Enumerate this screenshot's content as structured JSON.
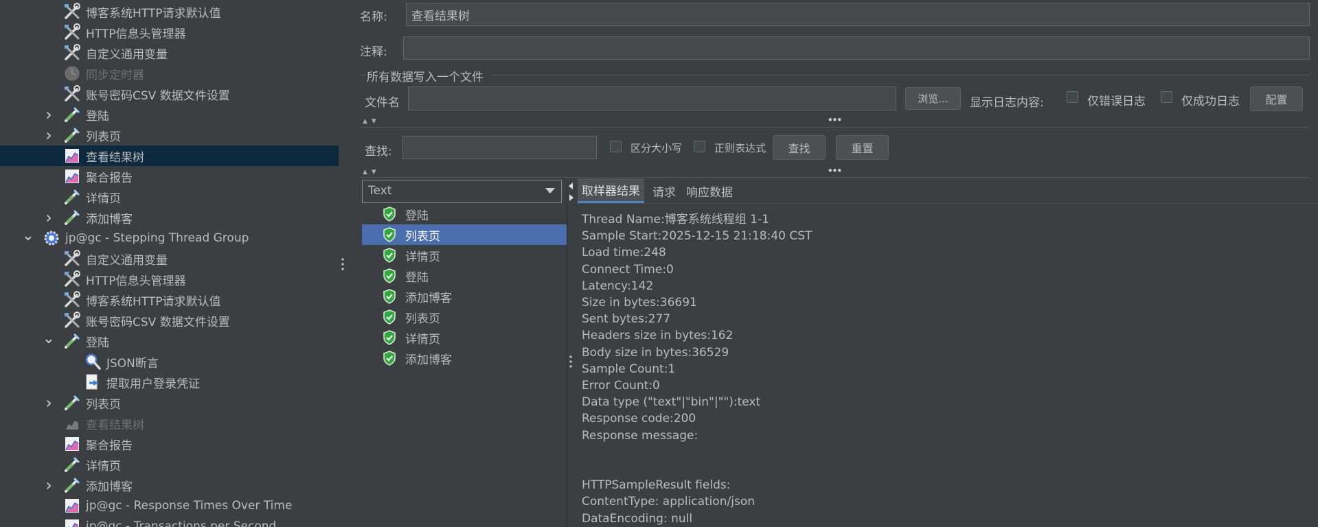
{
  "tree": {
    "items": [
      {
        "label": "博客系统HTTP请求默认值",
        "icon": "wrench-icon",
        "chevron": "",
        "disabled": false,
        "selected": false
      },
      {
        "label": "HTTP信息头管理器",
        "icon": "wrench-icon",
        "chevron": "",
        "disabled": false,
        "selected": false
      },
      {
        "label": "自定义通用变量",
        "icon": "wrench-icon",
        "chevron": "",
        "disabled": false,
        "selected": false
      },
      {
        "label": "同步定时器",
        "icon": "timer-icon",
        "chevron": "",
        "disabled": true,
        "selected": false
      },
      {
        "label": "账号密码CSV 数据文件设置",
        "icon": "wrench-icon",
        "chevron": "",
        "disabled": false,
        "selected": false
      },
      {
        "label": "登陆",
        "icon": "pipette-icon",
        "chevron": "collapsed",
        "disabled": false,
        "selected": false
      },
      {
        "label": "列表页",
        "icon": "pipette-icon",
        "chevron": "collapsed",
        "disabled": false,
        "selected": false
      },
      {
        "label": "查看结果树",
        "icon": "graph-icon",
        "chevron": "",
        "disabled": false,
        "selected": true
      },
      {
        "label": "聚合报告",
        "icon": "graph-icon",
        "chevron": "",
        "disabled": false,
        "selected": false
      },
      {
        "label": "详情页",
        "icon": "pipette-icon",
        "chevron": "",
        "disabled": false,
        "selected": false
      },
      {
        "label": "添加博客",
        "icon": "pipette-icon",
        "chevron": "collapsed",
        "disabled": false,
        "selected": false
      },
      {
        "label": "jp@gc - Stepping Thread Group",
        "icon": "gear-icon",
        "chevron": "expanded",
        "disabled": false,
        "selected": false
      },
      {
        "label": "自定义通用变量",
        "icon": "wrench-icon",
        "chevron": "",
        "disabled": false,
        "selected": false
      },
      {
        "label": "HTTP信息头管理器",
        "icon": "wrench-icon",
        "chevron": "",
        "disabled": false,
        "selected": false
      },
      {
        "label": "博客系统HTTP请求默认值",
        "icon": "wrench-icon",
        "chevron": "",
        "disabled": false,
        "selected": false
      },
      {
        "label": "账号密码CSV 数据文件设置",
        "icon": "wrench-icon",
        "chevron": "",
        "disabled": false,
        "selected": false
      },
      {
        "label": "登陆",
        "icon": "pipette-icon",
        "chevron": "expanded",
        "disabled": false,
        "selected": false
      },
      {
        "label": "JSON断言",
        "icon": "magnifier-icon",
        "chevron": "",
        "disabled": false,
        "selected": false
      },
      {
        "label": "提取用户登录凭证",
        "icon": "extractor-icon",
        "chevron": "",
        "disabled": false,
        "selected": false
      },
      {
        "label": "列表页",
        "icon": "pipette-icon",
        "chevron": "collapsed",
        "disabled": false,
        "selected": false
      },
      {
        "label": "查看结果树",
        "icon": "graph-icon",
        "chevron": "",
        "disabled": true,
        "selected": false
      },
      {
        "label": "聚合报告",
        "icon": "graph-icon",
        "chevron": "",
        "disabled": false,
        "selected": false
      },
      {
        "label": "详情页",
        "icon": "pipette-icon",
        "chevron": "",
        "disabled": false,
        "selected": false
      },
      {
        "label": "添加博客",
        "icon": "pipette-icon",
        "chevron": "collapsed",
        "disabled": false,
        "selected": false
      },
      {
        "label": "jp@gc - Response Times Over Time",
        "icon": "graph-icon",
        "chevron": "",
        "disabled": false,
        "selected": false
      },
      {
        "label": "jp@gc - Transactions per Second",
        "icon": "graph-icon",
        "chevron": "",
        "disabled": false,
        "selected": false
      }
    ]
  },
  "form": {
    "name_label": "名称:",
    "name_value": "查看结果树",
    "comment_label": "注释:",
    "comment_value": "",
    "file_section_title": "所有数据写入一个文件",
    "filename_label": "文件名",
    "filename_value": "",
    "browse_button": "浏览...",
    "log_display_label": "显示日志内容:",
    "errors_only_label": "仅错误日志",
    "success_only_label": "仅成功日志",
    "configure_button": "配置"
  },
  "search": {
    "label": "查找:",
    "value": "",
    "case_sensitive_label": "区分大小写",
    "regex_label": "正则表达式",
    "find_button": "查找",
    "reset_button": "重置"
  },
  "results": {
    "renderer_selected": "Text",
    "items": [
      {
        "label": "登陆",
        "status": "success"
      },
      {
        "label": "列表页",
        "status": "success",
        "selected": true
      },
      {
        "label": "详情页",
        "status": "success"
      },
      {
        "label": "登陆",
        "status": "success"
      },
      {
        "label": "添加博客",
        "status": "success"
      },
      {
        "label": "列表页",
        "status": "success"
      },
      {
        "label": "详情页",
        "status": "success"
      },
      {
        "label": "添加博客",
        "status": "success"
      }
    ]
  },
  "detail": {
    "tabs": [
      "取样器结果",
      "请求",
      "响应数据"
    ],
    "active_tab": "取样器结果",
    "lines": [
      "Thread Name:博客系统线程组 1-1",
      "Sample Start:2025-12-15 21:18:40 CST",
      "Load time:248",
      "Connect Time:0",
      "Latency:142",
      "Size in bytes:36691",
      "Sent bytes:277",
      "Headers size in bytes:162",
      "Body size in bytes:36529",
      "Sample Count:1",
      "Error Count:0",
      "Data type (\"text\"|\"bin\"|\"\"):text",
      "Response code:200",
      "Response message:",
      "",
      "",
      "HTTPSampleResult fields:",
      "ContentType: application/json",
      "DataEncoding: null"
    ]
  },
  "colors": {
    "background": "#3c3f41",
    "selection_tree": "#0d293e",
    "selection_list": "#4b6eaf",
    "success_green": "#2faa3a"
  }
}
